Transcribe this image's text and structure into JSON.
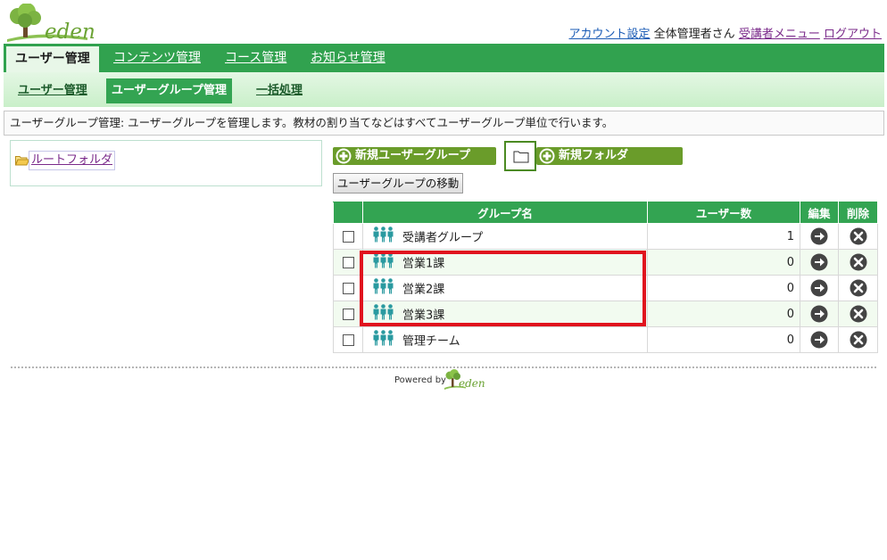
{
  "brand": {
    "logo_text": "eden"
  },
  "header": {
    "account_settings": "アカウント設定",
    "user_name": "全体管理者さん",
    "learner_menu": "受講者メニュー",
    "logout": "ログアウト"
  },
  "main_tabs": [
    {
      "label": "ユーザー管理",
      "active": true
    },
    {
      "label": "コンテンツ管理",
      "active": false
    },
    {
      "label": "コース管理",
      "active": false
    },
    {
      "label": "お知らせ管理",
      "active": false
    }
  ],
  "sub_tabs": [
    {
      "label": "ユーザー管理",
      "active": false
    },
    {
      "label": "ユーザーグループ管理",
      "active": true
    },
    {
      "label": "一括処理",
      "active": false
    }
  ],
  "description": "ユーザーグループ管理: ユーザーグループを管理します。教材の割り当てなどはすべてユーザーグループ単位で行います。",
  "tree": {
    "root_label": "ルートフォルダ"
  },
  "actions": {
    "new_group": "新規ユーザーグループ",
    "new_folder": "新規フォルダ",
    "move_group": "ユーザーグループの移動"
  },
  "table": {
    "columns": [
      "",
      "グループ名",
      "ユーザー数",
      "編集",
      "削除"
    ],
    "rows": [
      {
        "name": "受講者グループ",
        "users": "1",
        "checked": false
      },
      {
        "name": "営業1課",
        "users": "0",
        "checked": false
      },
      {
        "name": "営業2課",
        "users": "0",
        "checked": false
      },
      {
        "name": "営業3課",
        "users": "0",
        "checked": false
      },
      {
        "name": "管理チーム",
        "users": "0",
        "checked": false
      }
    ]
  },
  "footer": {
    "powered_by": "Powered by",
    "logo_text": "eden"
  },
  "colors": {
    "accent_green": "#31a24f",
    "button_green": "#6a9c2a",
    "highlight_red": "#e0131e",
    "link_blue": "#1a5bb5",
    "visited_purple": "#7a2a8a"
  }
}
